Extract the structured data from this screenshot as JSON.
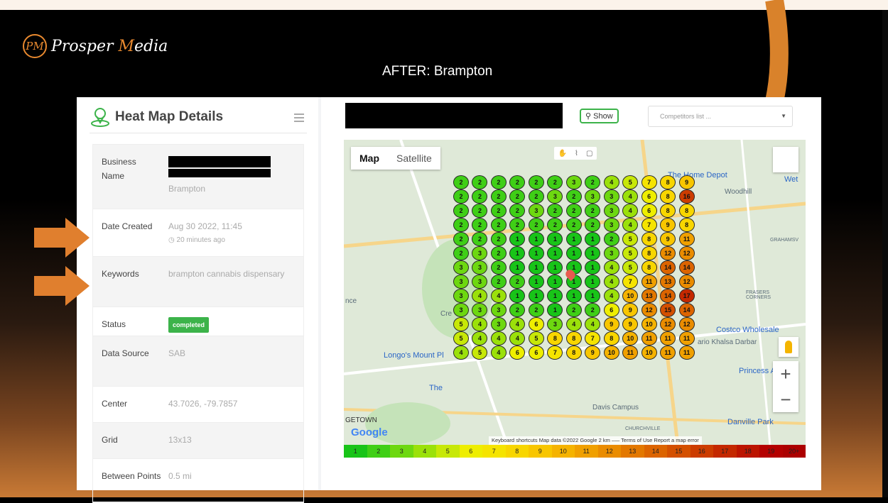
{
  "slide": {
    "logo_mark": "PM",
    "logo_p": "P",
    "logo_rosper": "rosper",
    "logo_m": "M",
    "logo_edia": "edia",
    "title": "AFTER: Brampton"
  },
  "left_panel": {
    "title": "Heat Map Details",
    "rows": {
      "business_name": {
        "label": "Business Name",
        "value": "Brampton"
      },
      "date_created": {
        "label": "Date Created",
        "value": "Aug 30 2022, 11:45",
        "sub": "20 minutes ago"
      },
      "keywords": {
        "label": "Keywords",
        "value": "brampton cannabis dispensary"
      },
      "status": {
        "label": "Status",
        "value": "completed"
      },
      "data_source": {
        "label": "Data Source",
        "value": "SAB"
      },
      "center": {
        "label": "Center",
        "value": "43.7026, -79.7857"
      },
      "grid": {
        "label": "Grid",
        "value": "13x13"
      },
      "between": {
        "label": "Between Points",
        "value": "0.5 mi"
      }
    }
  },
  "right_panel": {
    "show_button": "Show",
    "competitors_placeholder": "Competitors list ...",
    "map_tab": "Map",
    "satellite_tab": "Satellite",
    "google_logo": "Google",
    "attribution": "Keyboard shortcuts   Map data ©2022 Google   2 km ⎯⎯⎯   Terms of Use   Report a map error",
    "place_labels": {
      "home_depot": "The Home Depot",
      "woodhill": "Woodhill",
      "grahamsv": "GRAHAMSV",
      "frasers": "FRASERS CORNERS",
      "costco": "Costco Wholesale",
      "khalsa": "ario Khalsa Darbar",
      "longos": "Longo's Mount Pl",
      "princess": "Princess Auto",
      "danville": "Danville Park",
      "churchville": "CHURCHVILLE",
      "getown": "GETOWN",
      "davis": "Davis Campus",
      "cre": "Cre",
      "nce": "nce",
      "the": "The",
      "wet": "Wet"
    }
  },
  "heat_grid": [
    [
      2,
      2,
      2,
      2,
      2,
      2,
      3,
      2,
      4,
      5,
      7,
      8,
      9
    ],
    [
      2,
      2,
      2,
      2,
      2,
      3,
      2,
      3,
      3,
      4,
      6,
      8,
      16
    ],
    [
      2,
      2,
      2,
      2,
      3,
      2,
      2,
      2,
      3,
      4,
      6,
      8,
      8
    ],
    [
      2,
      2,
      2,
      2,
      2,
      2,
      2,
      2,
      3,
      4,
      7,
      9,
      8
    ],
    [
      2,
      2,
      2,
      1,
      1,
      1,
      1,
      1,
      2,
      5,
      8,
      9,
      11
    ],
    [
      2,
      3,
      2,
      1,
      1,
      1,
      1,
      1,
      3,
      5,
      8,
      12,
      12
    ],
    [
      3,
      3,
      2,
      1,
      1,
      1,
      1,
      1,
      4,
      5,
      8,
      14,
      14
    ],
    [
      3,
      3,
      2,
      2,
      1,
      1,
      1,
      1,
      4,
      7,
      11,
      13,
      12
    ],
    [
      3,
      4,
      4,
      1,
      1,
      1,
      1,
      1,
      4,
      10,
      13,
      14,
      17
    ],
    [
      3,
      3,
      3,
      2,
      2,
      1,
      2,
      2,
      6,
      9,
      12,
      15,
      14
    ],
    [
      5,
      4,
      3,
      4,
      6,
      3,
      4,
      4,
      9,
      9,
      10,
      12,
      12
    ],
    [
      5,
      4,
      4,
      4,
      5,
      8,
      8,
      7,
      8,
      10,
      11,
      11,
      11
    ],
    [
      4,
      5,
      4,
      6,
      6,
      7,
      8,
      9,
      10,
      11,
      10,
      11,
      11
    ]
  ],
  "legend": [
    "1",
    "2",
    "3",
    "4",
    "5",
    "6",
    "7",
    "8",
    "9",
    "10",
    "11",
    "12",
    "13",
    "14",
    "15",
    "16",
    "17",
    "18",
    "19",
    "20+"
  ],
  "colors": {
    "accent_orange": "#e8892f",
    "status_green": "#3cb34a",
    "scale": [
      "#18c418",
      "#3fcf16",
      "#6dd810",
      "#9be10a",
      "#c7e807",
      "#eeee00",
      "#f5e400",
      "#f8d600",
      "#f8c600",
      "#f5b300",
      "#f0a000",
      "#ea8c00",
      "#e37800",
      "#dc6400",
      "#d45000",
      "#cc3c00",
      "#c42800",
      "#bc1400",
      "#b40000",
      "#ac0000"
    ]
  }
}
